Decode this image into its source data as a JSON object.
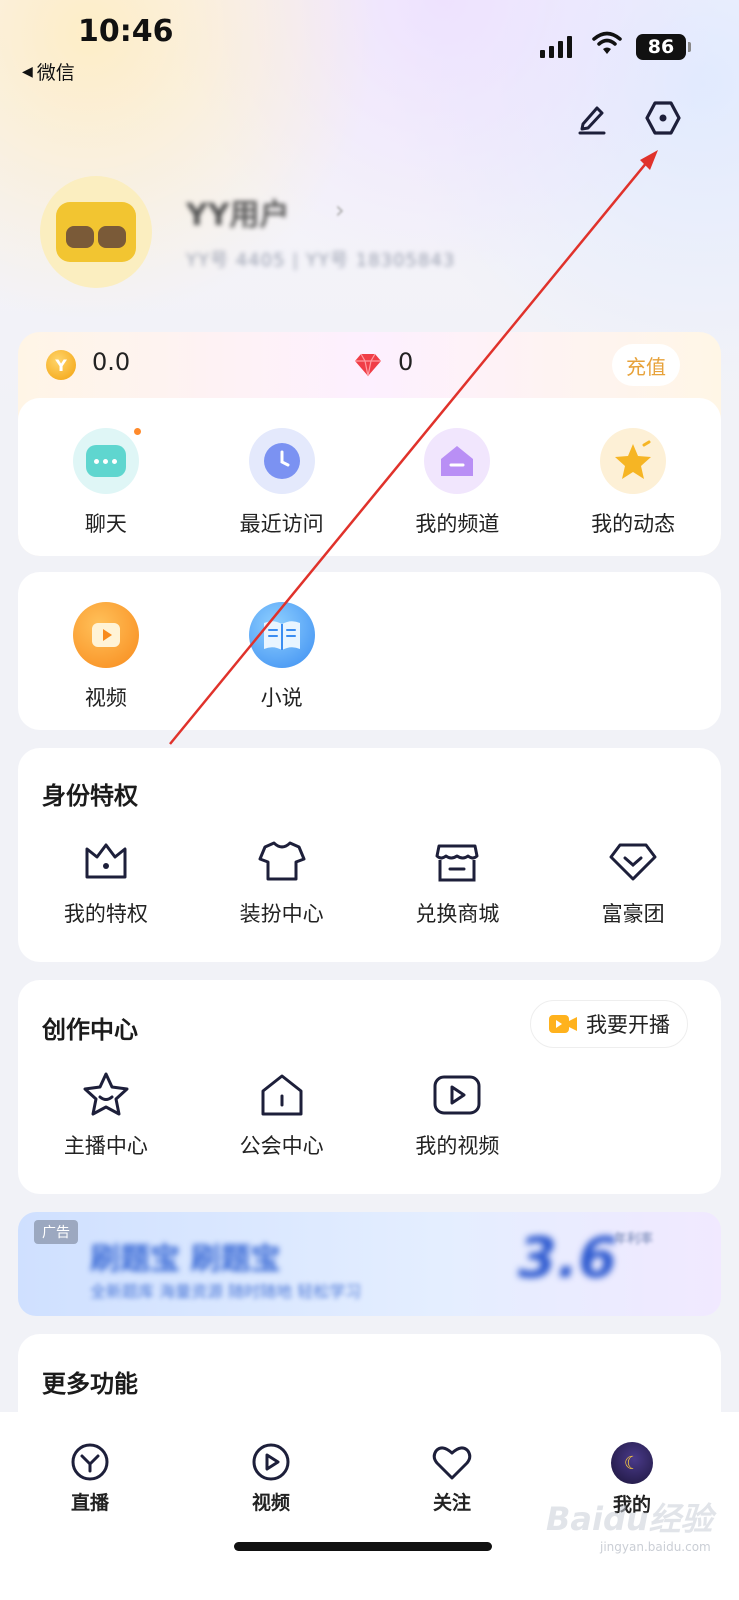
{
  "status_bar": {
    "time": "10:46",
    "back_app": "微信",
    "battery": "86"
  },
  "header": {
    "edit_icon": "pencil-icon",
    "settings_icon": "hexagon-settings-icon"
  },
  "profile": {
    "username": "YY用户",
    "user_id": "YY号 4405 | YY号 18305843"
  },
  "wallet": {
    "coin_value": "0.0",
    "diamond_value": "0",
    "recharge_label": "充值"
  },
  "quick_actions": [
    {
      "label": "聊天",
      "icon": "chat-icon",
      "color": "#5fd6cf"
    },
    {
      "label": "最近访问",
      "icon": "clock-icon",
      "color": "#7b92f2"
    },
    {
      "label": "我的频道",
      "icon": "channel-home-icon",
      "color": "#b98ff5"
    },
    {
      "label": "我的动态",
      "icon": "star-icon",
      "color": "#f6b524"
    }
  ],
  "media": [
    {
      "label": "视频",
      "icon": "video-play-icon"
    },
    {
      "label": "小说",
      "icon": "book-icon"
    }
  ],
  "privileges": {
    "title": "身份特权",
    "items": [
      {
        "label": "我的特权",
        "icon": "crown-icon"
      },
      {
        "label": "装扮中心",
        "icon": "tshirt-icon"
      },
      {
        "label": "兑换商城",
        "icon": "store-icon"
      },
      {
        "label": "富豪团",
        "icon": "diamond-v-icon"
      }
    ]
  },
  "creation": {
    "title": "创作中心",
    "live_button": "我要开播",
    "items": [
      {
        "label": "主播中心",
        "icon": "star-outline-icon"
      },
      {
        "label": "公会中心",
        "icon": "guild-house-icon"
      },
      {
        "label": "我的视频",
        "icon": "video-outline-icon"
      }
    ]
  },
  "ad": {
    "tag": "广告",
    "title": "刷题宝 刷题宝",
    "subtitle": "全新题库 海量资源 随时随地 轻松学习",
    "big_text": "3.6",
    "small_text": "年利率"
  },
  "more": {
    "title": "更多功能"
  },
  "bottom_nav": [
    {
      "label": "直播",
      "icon": "live-y-icon"
    },
    {
      "label": "视频",
      "icon": "video-play-icon"
    },
    {
      "label": "关注",
      "icon": "heart-icon"
    },
    {
      "label": "我的",
      "icon": "avatar-moon-icon"
    }
  ],
  "watermark": {
    "text": "Baidu经验",
    "sub": "jingyan.baidu.com"
  },
  "colors": {
    "accent_orange": "#ff8a2b",
    "recharge_text": "#e7a23a",
    "annotation_arrow": "#e0322b"
  }
}
